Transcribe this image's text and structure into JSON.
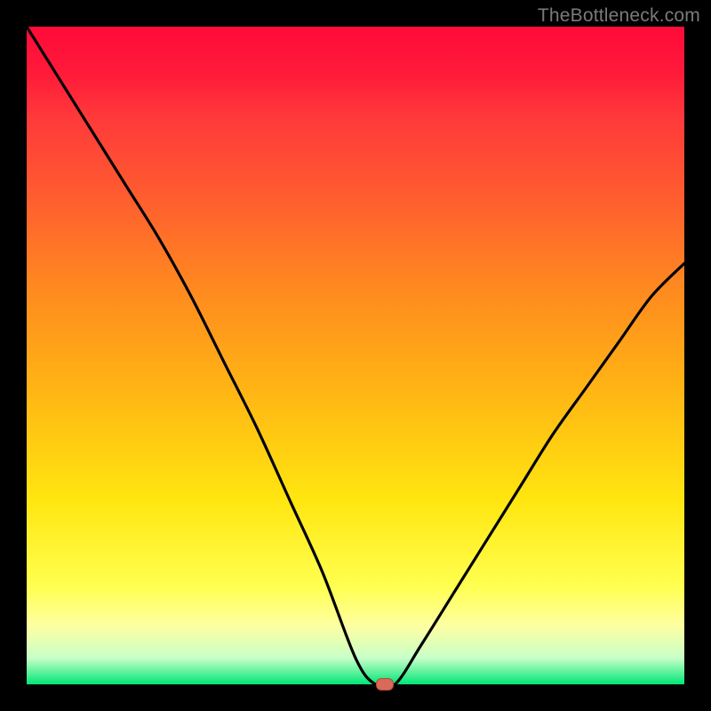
{
  "watermark": "TheBottleneck.com",
  "chart_data": {
    "type": "line",
    "title": "",
    "xlabel": "",
    "ylabel": "",
    "xlim": [
      0,
      100
    ],
    "ylim": [
      0,
      100
    ],
    "grid": false,
    "series": [
      {
        "name": "bottleneck-curve",
        "x": [
          0,
          5,
          10,
          15,
          20,
          25,
          30,
          35,
          40,
          45,
          50,
          53,
          56,
          60,
          65,
          70,
          75,
          80,
          85,
          90,
          95,
          100
        ],
        "y": [
          100,
          92,
          84,
          76,
          68,
          59,
          49,
          39,
          28,
          17,
          4,
          0,
          0,
          6,
          14,
          22,
          30,
          38,
          45,
          52,
          59,
          64
        ]
      }
    ],
    "marker": {
      "x": 54.5,
      "y": 0
    },
    "background_gradient": {
      "direction": "vertical",
      "stops": [
        {
          "pos": 0.0,
          "color": "#ff0a3a"
        },
        {
          "pos": 0.25,
          "color": "#ff5a30"
        },
        {
          "pos": 0.55,
          "color": "#ffb414"
        },
        {
          "pos": 0.85,
          "color": "#ffff50"
        },
        {
          "pos": 1.0,
          "color": "#00e676"
        }
      ]
    }
  }
}
